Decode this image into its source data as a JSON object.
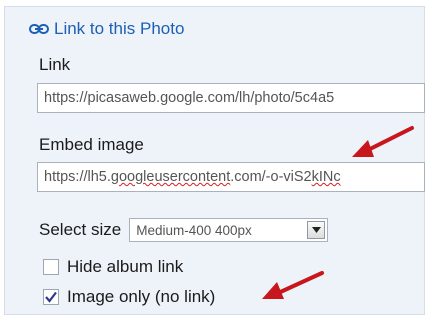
{
  "panel": {
    "title": "Link to this Photo",
    "link_label": "Link",
    "link_value": "https://picasaweb.google.com/lh/photo/5c4a5",
    "embed_label": "Embed image",
    "embed_value_prefix": "https://lh5.",
    "embed_value_misspelled": "googleusercontent",
    "embed_value_mid": ".com/-o-viS2",
    "embed_value_suffix": "kINc",
    "select_size_label": "Select size",
    "select_size_value": "Medium-400 400px",
    "hide_album_label": "Hide album link",
    "hide_album_checked": false,
    "image_only_label": "Image only (no link)",
    "image_only_checked": true
  },
  "colors": {
    "accent": "#1c5fb4",
    "panel_bg": "#eef3fa",
    "arrow": "#c8161d"
  },
  "icons": [
    "link-icon",
    "chevron-down-icon",
    "checkmark-icon",
    "arrow-annotation"
  ]
}
